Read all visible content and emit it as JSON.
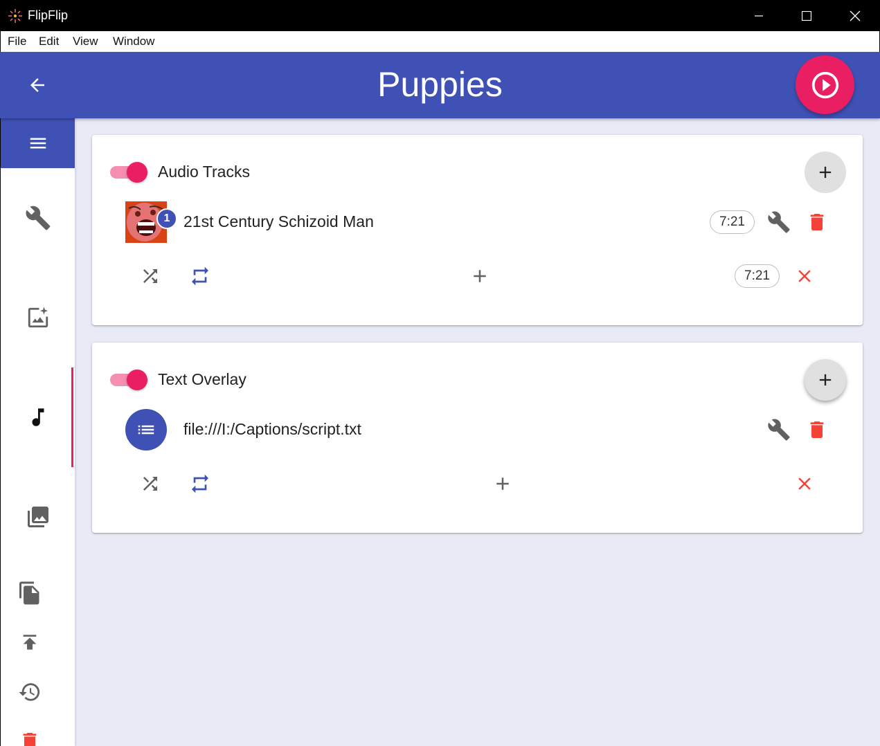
{
  "window": {
    "title": "FlipFlip",
    "controls": [
      "minimize",
      "maximize",
      "close"
    ]
  },
  "menu": [
    "File",
    "Edit",
    "View",
    "Window"
  ],
  "appbar": {
    "title": "Puppies",
    "back_icon": "arrow-back-icon",
    "play_icon": "play-circle-icon",
    "accent_color": "#3f51b5",
    "fab_color": "#e91e63"
  },
  "sidebar": {
    "tabs": [
      {
        "name": "options",
        "icon": "wrench-icon"
      },
      {
        "name": "effects",
        "icon": "image-sparkle-icon"
      },
      {
        "name": "audio-text",
        "icon": "music-note-icon",
        "active": true
      },
      {
        "name": "sources",
        "icon": "photo-library-icon"
      }
    ],
    "actions": [
      {
        "name": "clone",
        "icon": "file-copy-icon"
      },
      {
        "name": "export",
        "icon": "publish-icon"
      },
      {
        "name": "history",
        "icon": "history-icon"
      },
      {
        "name": "delete",
        "icon": "delete-icon"
      }
    ]
  },
  "audio_card": {
    "title": "Audio Tracks",
    "enabled": true,
    "track": {
      "badge": "1",
      "title": "21st Century Schizoid Man",
      "duration": "7:21"
    },
    "footer": {
      "duration": "7:21"
    }
  },
  "text_card": {
    "title": "Text Overlay",
    "enabled": true,
    "item": {
      "title": "file:///I:/Captions/script.txt"
    }
  }
}
